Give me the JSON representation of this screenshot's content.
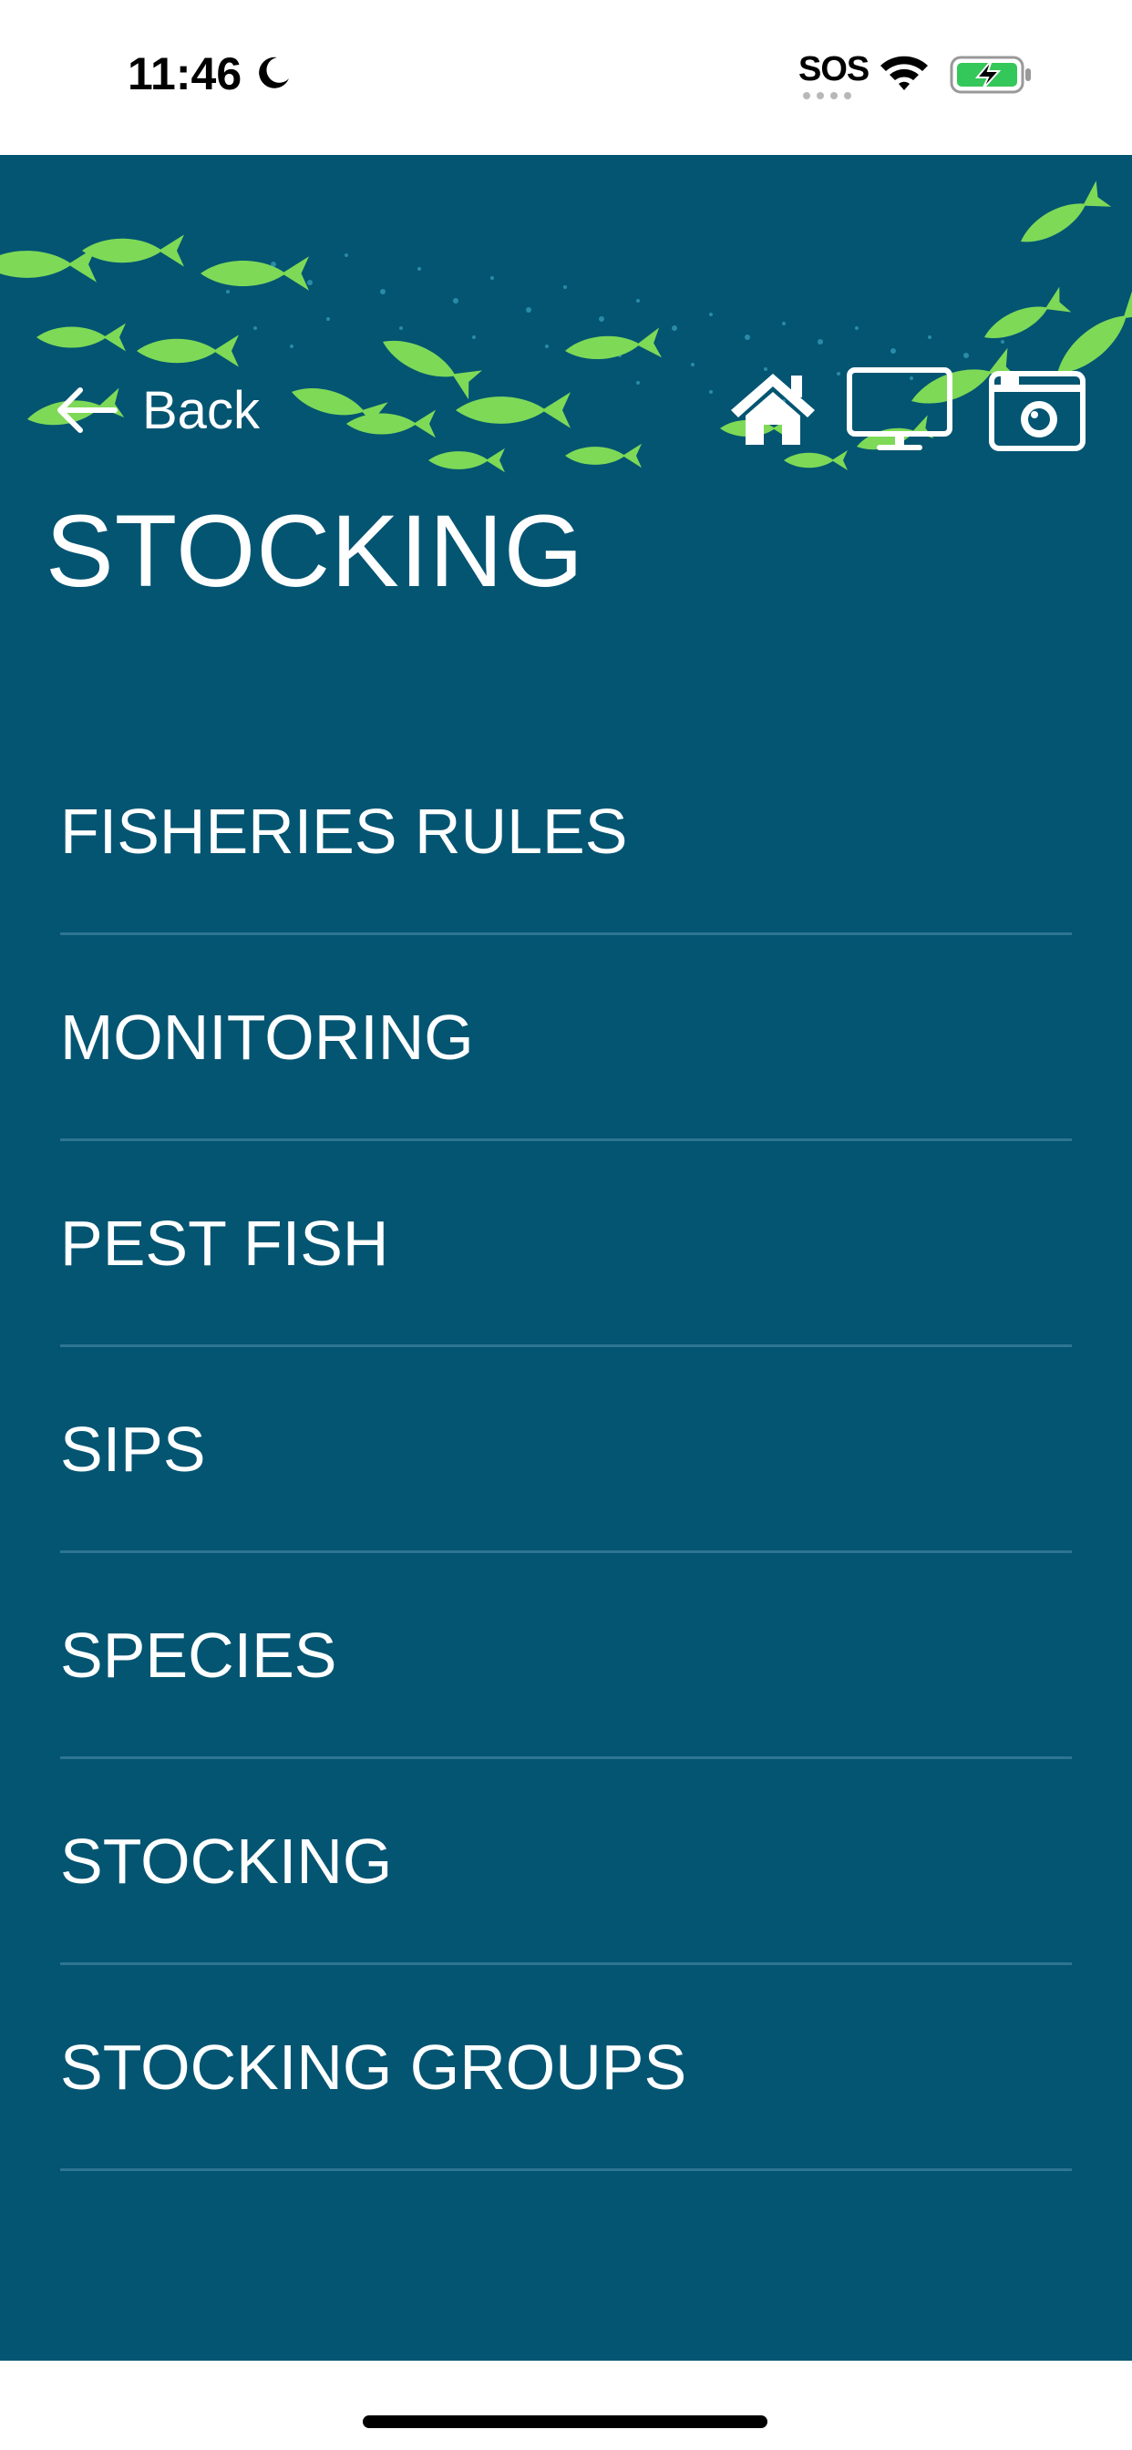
{
  "status_bar": {
    "time": "11:46",
    "sos": "SOS",
    "icons": [
      "moon-icon",
      "wifi-icon",
      "battery-charging-icon"
    ]
  },
  "header": {
    "back_label": "Back",
    "icons": [
      "home-icon",
      "monitor-icon",
      "camera-icon"
    ],
    "banner": "fish-school-banner"
  },
  "page": {
    "title": "STOCKING"
  },
  "menu": {
    "items": [
      {
        "label": "FISHERIES RULES"
      },
      {
        "label": "MONITORING"
      },
      {
        "label": "PEST FISH"
      },
      {
        "label": "SIPS"
      },
      {
        "label": "SPECIES"
      },
      {
        "label": "STOCKING"
      },
      {
        "label": "STOCKING GROUPS"
      }
    ]
  },
  "colors": {
    "background": "#035572",
    "fish": "#7ed957",
    "text": "#ffffff",
    "divider": "#2f7591"
  }
}
